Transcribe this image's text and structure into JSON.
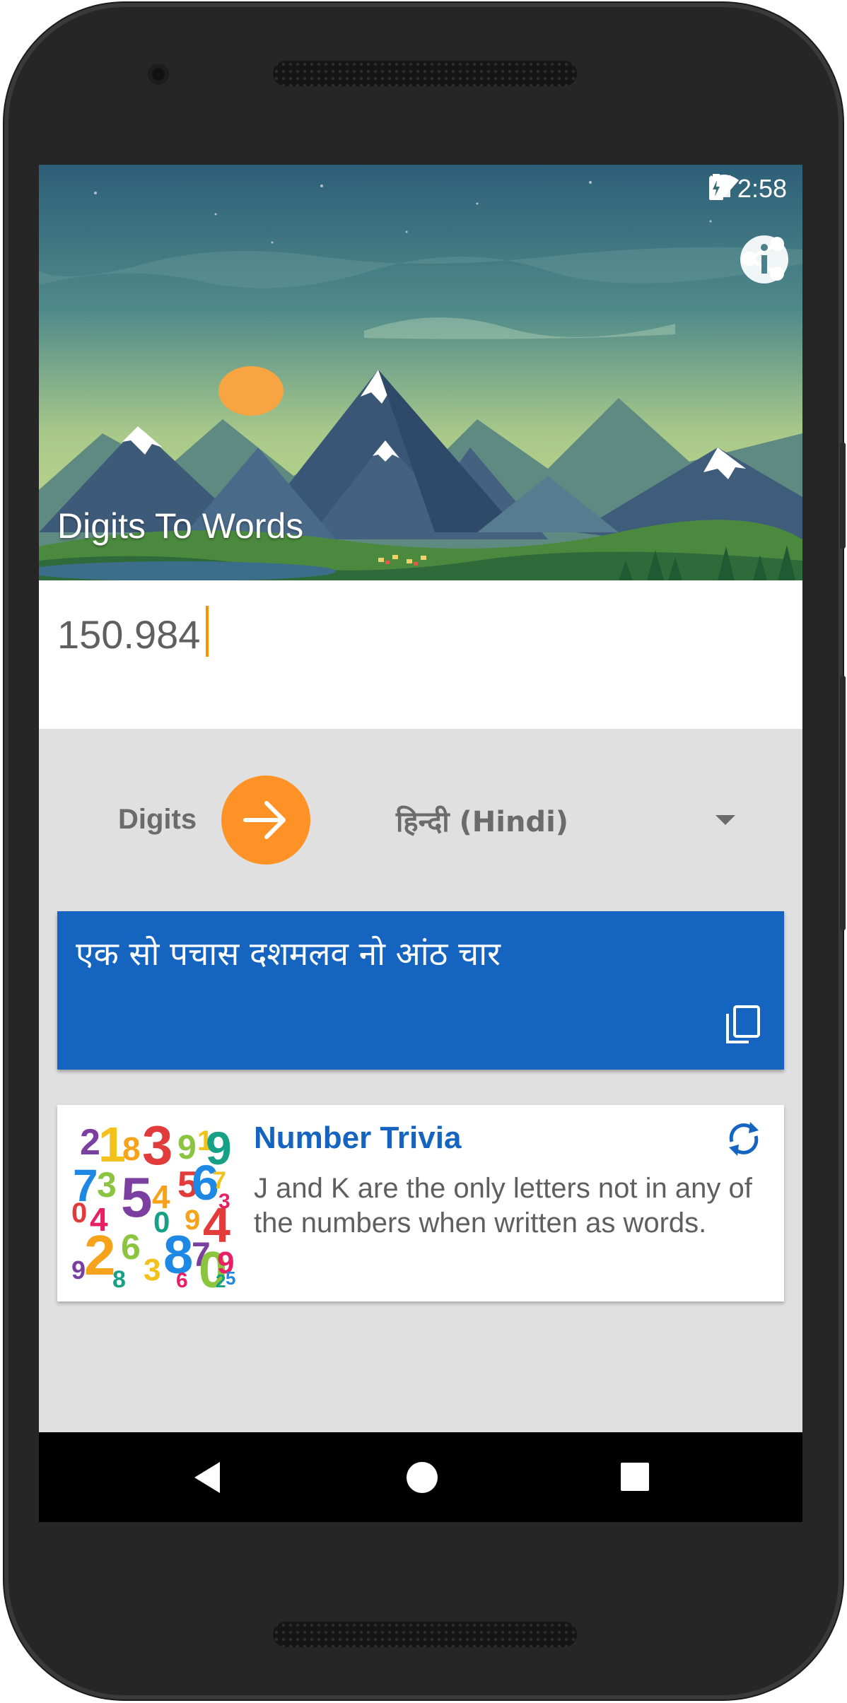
{
  "status_bar": {
    "time": "2:58",
    "icons": [
      "wifi-icon",
      "signal-icon",
      "battery-charging-icon"
    ]
  },
  "toolbar": {
    "title": "Digits To Words",
    "actions": [
      "share-icon",
      "info-icon"
    ]
  },
  "input": {
    "value": "150.984",
    "placeholder": ""
  },
  "conversion": {
    "from_label": "Digits",
    "to_language": "हिन्दी (Hindi)",
    "arrow": "arrow-right-icon"
  },
  "result": {
    "text": "एक सो पचास दशमलव नो आंठ चार",
    "copy": "copy-icon"
  },
  "trivia": {
    "title": "Number Trivia",
    "text": "J and K are the only letters not in any of the numbers when written as words.",
    "refresh": "refresh-icon"
  },
  "nav": [
    "back-icon",
    "home-icon",
    "recents-icon"
  ],
  "colors": {
    "accent": "#ff9226",
    "primary": "#1565c0",
    "background": "#e0e0e0"
  }
}
